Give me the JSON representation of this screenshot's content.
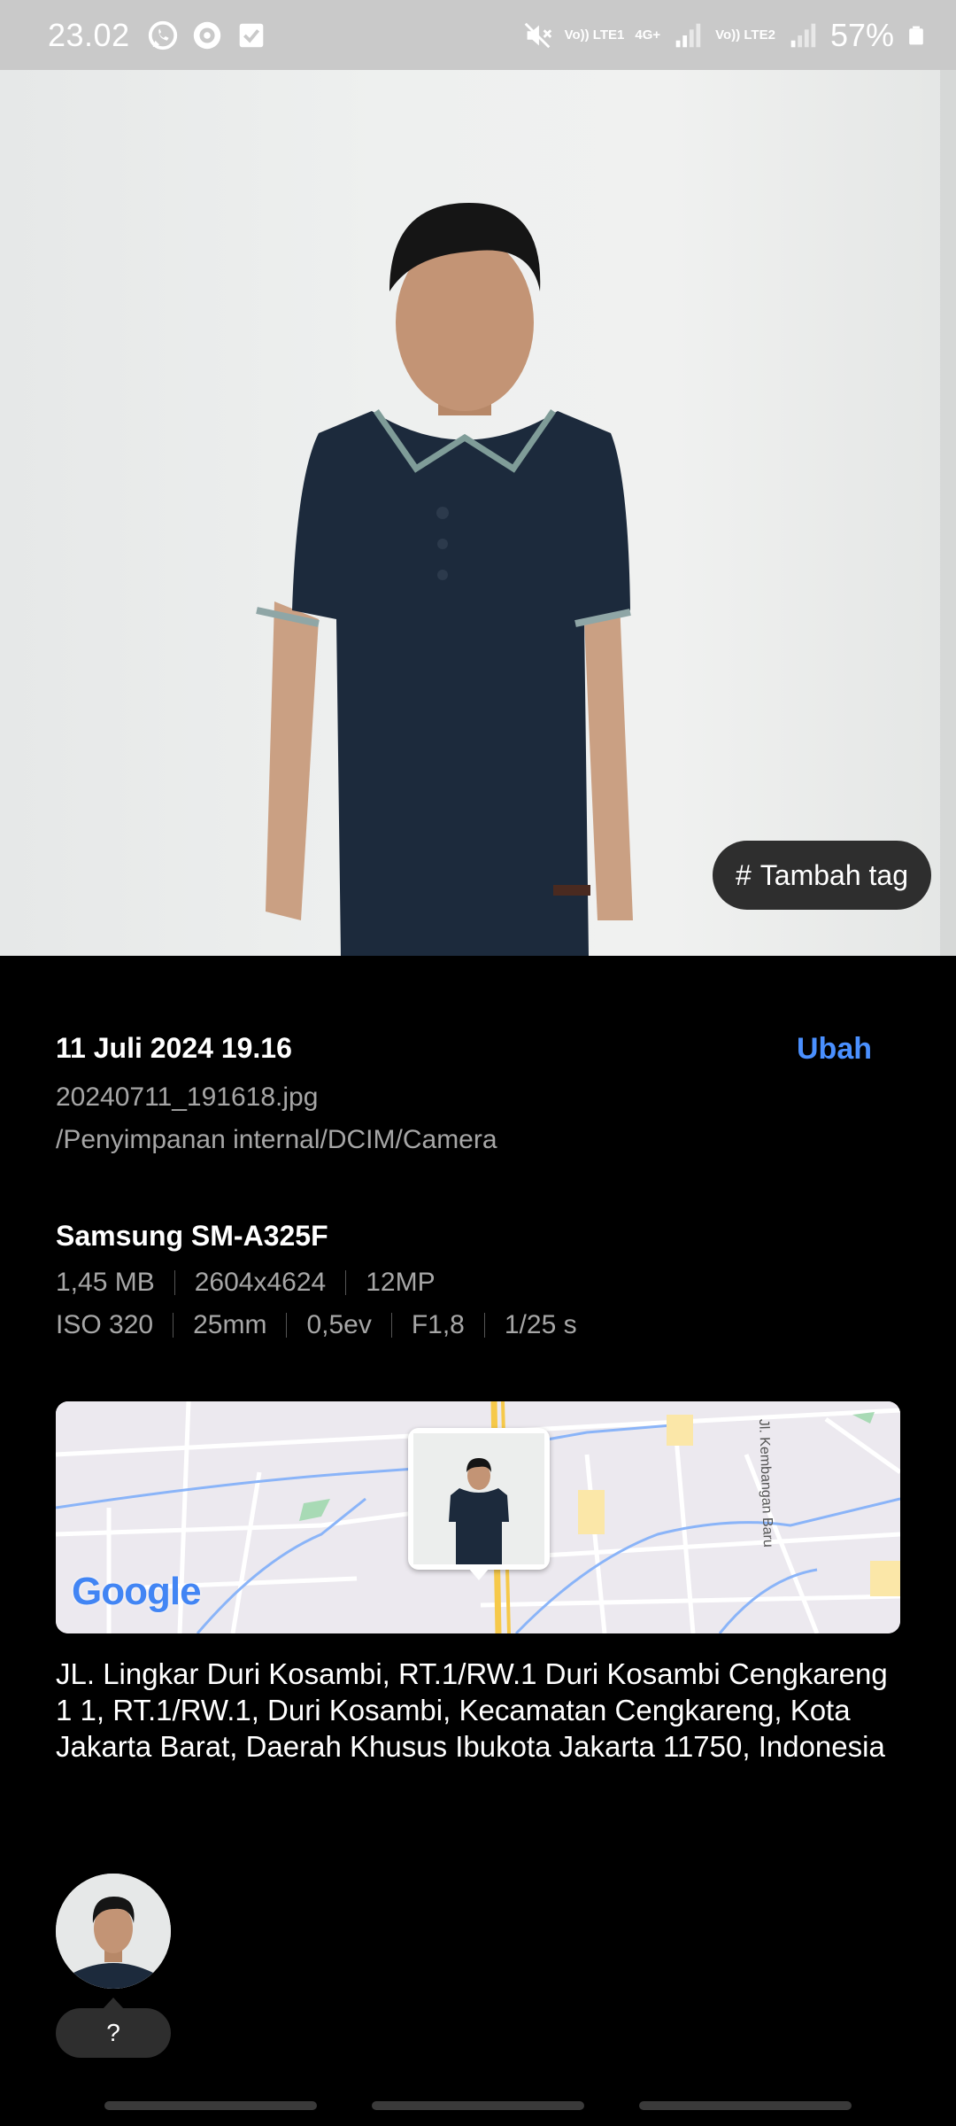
{
  "status_bar": {
    "time": "23.02",
    "network1": "Vo)) LTE1",
    "network2": "Vo)) LTE2",
    "network_type": "4G+",
    "battery": "57%",
    "icons": [
      "whatsapp-icon",
      "record-icon",
      "checkbox-icon",
      "mute-icon",
      "signal-icon",
      "battery-icon"
    ]
  },
  "photo": {
    "tag_button_label": "Tambah tag",
    "tag_icon": "#"
  },
  "details": {
    "date": "11 Juli 2024 19.16",
    "edit_label": "Ubah",
    "filename": "20240711_191618.jpg",
    "path": "/Penyimpanan internal/DCIM/Camera",
    "device": "Samsung SM-A325F",
    "size": "1,45 MB",
    "resolution": "2604x4624",
    "megapixels": "12MP",
    "iso": "ISO 320",
    "focal_length": "25mm",
    "exposure": "0,5ev",
    "aperture": "F1,8",
    "shutter": "1/25 s"
  },
  "map": {
    "provider": "Google",
    "road_label": "Jl. Kembangan Baru"
  },
  "address": "JL. Lingkar Duri Kosambi, RT.1/RW.1 Duri Kosambi Cengkareng 1 1, RT.1/RW.1, Duri Kosambi, Kecamatan Cengkareng, Kota Jakarta Barat, Daerah Khusus Ibukota Jakarta 11750, Indonesia",
  "people": {
    "unknown_label": "?"
  },
  "colors": {
    "accent": "#4a90ff",
    "background": "#000000",
    "secondary_text": "#a6a6a6",
    "chip": "#2e2e2e"
  }
}
